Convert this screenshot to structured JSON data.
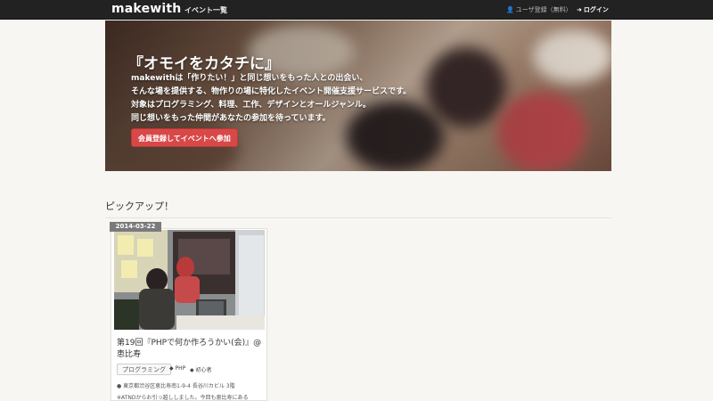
{
  "navbar": {
    "brand": "makewith",
    "event_list": "イベント一覧",
    "register": "ユーザ登録（無料）",
    "login": "ログイン"
  },
  "hero": {
    "title": "『オモイをカタチに』",
    "lines": [
      "makewithは「作りたい！」と同じ想いをもった人との出会い、",
      "そんな場を提供する、物作りの場に特化したイベント開催支援サービスです。",
      "対象はプログラミング、料理、工作、デザインとオールジャンル。",
      "同じ想いをもった仲間があなたの参加を待っています。"
    ],
    "cta": "会員登録してイベントへ参加"
  },
  "pickup": {
    "title": "ピックアップ！",
    "card": {
      "date": "2014-03-22",
      "title": "第19回『PHPで何か作ろうかい(会)』@恵比寿",
      "tags": [
        "プログラミング",
        "PHP",
        "初心者"
      ],
      "address": "東京都渋谷区恵比寿南1-9-4 長谷川カビル 3階",
      "note": "※ATNDからお引っ越ししました。今回も恵比寿にある"
    }
  },
  "colors": {
    "navbar": "#222222",
    "cta": "#d94848",
    "background": "#f7f6f2"
  }
}
